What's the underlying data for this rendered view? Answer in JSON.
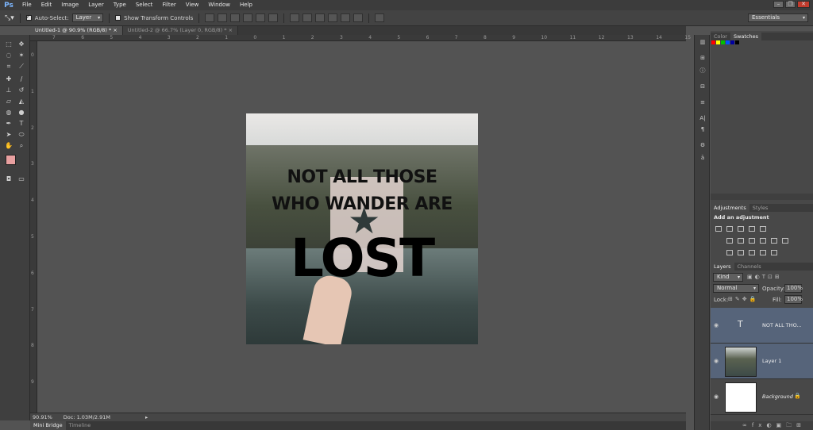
{
  "app": {
    "logo": "Ps"
  },
  "menu": [
    "File",
    "Edit",
    "Image",
    "Layer",
    "Type",
    "Select",
    "Filter",
    "View",
    "Window",
    "Help"
  ],
  "options": {
    "auto_select_label": "Auto-Select:",
    "auto_select_value": "Layer",
    "show_transform_label": "Show Transform Controls",
    "workspace": "Essentials"
  },
  "tabs": [
    {
      "label": "Untitled-1 @ 90.9% (RGB/8) *"
    },
    {
      "label": "Untitled-2 @ 66.7% (Layer 0, RGB/8) *"
    }
  ],
  "ruler": {
    "h": [
      "7",
      "6",
      "5",
      "4",
      "3",
      "2",
      "1",
      "0",
      "1",
      "2",
      "3",
      "4",
      "5",
      "6",
      "7",
      "8",
      "9",
      "10",
      "11",
      "12",
      "13",
      "14",
      "15"
    ],
    "v": [
      "0",
      "1",
      "2",
      "3",
      "4",
      "5",
      "6",
      "7",
      "8",
      "9"
    ]
  },
  "canvas": {
    "line1": "NOT ALL THOSE",
    "line2": "WHO WANDER ARE",
    "line3": "LOST"
  },
  "status": {
    "zoom": "90.91%",
    "doc": "Doc: 1.03M/2.91M"
  },
  "bottom_tabs": [
    "Mini Bridge",
    "Timeline"
  ],
  "panels": {
    "color_tabs": [
      "Color",
      "Swatches"
    ],
    "swatches": [
      "#ff0000",
      "#ffff00",
      "#00c000",
      "#0050ff",
      "#0000a0",
      "#000000"
    ],
    "adj_tabs": [
      "Adjustments",
      "Styles"
    ],
    "adj_title": "Add an adjustment",
    "layer_tabs": [
      "Layers",
      "Channels"
    ],
    "kind": "Kind",
    "blend": "Normal",
    "opacity_label": "Opacity:",
    "opacity": "100%",
    "lock_label": "Lock:",
    "fill_label": "Fill:",
    "fill": "100%",
    "layers": [
      {
        "name": "NOT ALL THO..."
      },
      {
        "name": "Layer 1"
      },
      {
        "name": "Background"
      }
    ]
  }
}
